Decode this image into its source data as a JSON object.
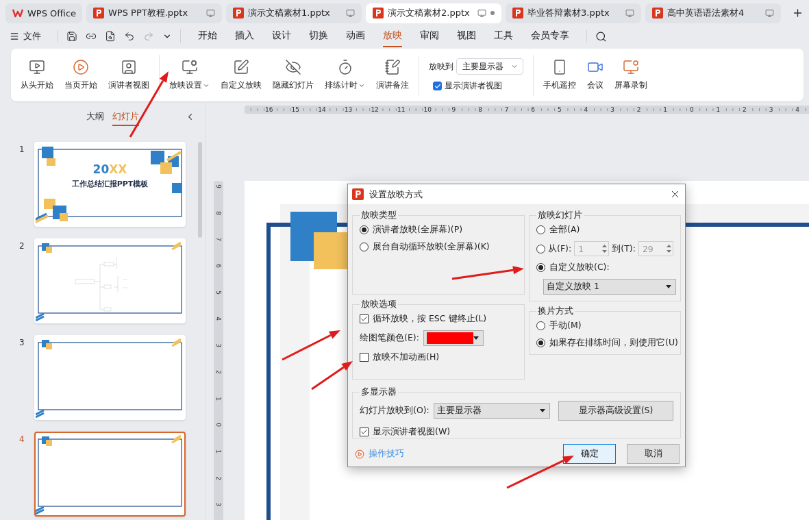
{
  "tabs": [
    {
      "label": "WPS Office",
      "kind": "home",
      "selected": false
    },
    {
      "label": "WPS PPT教程.pptx",
      "kind": "doc",
      "selected": false,
      "unsaved": false
    },
    {
      "label": "演示文稿素材1.pptx",
      "kind": "doc",
      "selected": false,
      "unsaved": false
    },
    {
      "label": "演示文稿素材2.pptx",
      "kind": "doc",
      "selected": true,
      "unsaved": true
    },
    {
      "label": "毕业答辩素材3.pptx",
      "kind": "doc",
      "selected": false,
      "unsaved": false
    },
    {
      "label": "高中英语语法素材4",
      "kind": "doc",
      "selected": false,
      "unsaved": false
    }
  ],
  "menu": {
    "file": "文件",
    "tabs": [
      {
        "label": "开始",
        "selected": false
      },
      {
        "label": "插入",
        "selected": false
      },
      {
        "label": "设计",
        "selected": false
      },
      {
        "label": "切换",
        "selected": false
      },
      {
        "label": "动画",
        "selected": false
      },
      {
        "label": "放映",
        "selected": true
      },
      {
        "label": "审阅",
        "selected": false
      },
      {
        "label": "视图",
        "selected": false
      },
      {
        "label": "工具",
        "selected": false
      },
      {
        "label": "会员专享",
        "selected": false
      }
    ]
  },
  "ribbon": {
    "group_1": [
      {
        "label": "从头开始",
        "dropdown": false
      },
      {
        "label": "当页开始",
        "dropdown": false
      },
      {
        "label": "演讲者视图",
        "dropdown": false
      }
    ],
    "group_2": [
      {
        "label": "放映设置",
        "dropdown": true
      },
      {
        "label": "自定义放映",
        "dropdown": false
      },
      {
        "label": "隐藏幻灯片",
        "dropdown": false
      },
      {
        "label": "排练计时",
        "dropdown": true
      },
      {
        "label": "演讲备注",
        "dropdown": false
      }
    ],
    "show_to": {
      "label": "放映到",
      "value": "主要显示器"
    },
    "presenter_view": {
      "label": "显示演讲者视图",
      "checked": true
    },
    "group_3": [
      {
        "label": "手机遥控",
        "dropdown": false
      },
      {
        "label": "会议",
        "dropdown": false
      },
      {
        "label": "屏幕录制",
        "dropdown": false
      }
    ]
  },
  "panel": {
    "tabs": [
      {
        "label": "大纲",
        "selected": false
      },
      {
        "label": "幻灯片",
        "selected": true
      }
    ],
    "slides": [
      {
        "number": "1",
        "kind": "title",
        "selected": false,
        "heading_a": "20",
        "heading_b": "XX",
        "title": "工作总结汇报PPT模板"
      },
      {
        "number": "2",
        "kind": "mindmap",
        "selected": false
      },
      {
        "number": "3",
        "kind": "blank",
        "selected": false
      },
      {
        "number": "4",
        "kind": "blank",
        "selected": true
      }
    ]
  },
  "rulers": {
    "horizontal": [
      "16",
      "15",
      "14",
      "13",
      "12",
      "11",
      "10",
      "9",
      "8",
      "7",
      "6",
      "5",
      "4",
      "3",
      "2",
      "1",
      "0",
      "1",
      "2",
      "3",
      "4"
    ],
    "vertical": [
      "9",
      "8",
      "7",
      "6",
      "5",
      "4",
      "3",
      "2",
      "1",
      "0",
      "1",
      "2",
      "3"
    ]
  },
  "dialog": {
    "title": "设置放映方式",
    "show_type": {
      "legend": "放映类型",
      "options": [
        {
          "label": "演讲者放映(全屏幕)(P)",
          "selected": true
        },
        {
          "label": "展台自动循环放映(全屏幕)(K)",
          "selected": false
        }
      ]
    },
    "slides": {
      "legend": "放映幻灯片",
      "all": {
        "label": "全部(A)",
        "selected": false
      },
      "range": {
        "label": "从(F):",
        "selected": false,
        "from": "1",
        "to_label": "到(T):",
        "to": "29"
      },
      "custom": {
        "label": "自定义放映(C):",
        "selected": true,
        "value": "自定义放映 1"
      }
    },
    "options": {
      "legend": "放映选项",
      "loop": {
        "label": "循环放映，按 ESC 键终止(L)",
        "checked": true
      },
      "pen_label": "绘图笔颜色(E):",
      "no_animation": {
        "label": "放映不加动画(H)",
        "checked": false
      }
    },
    "advance": {
      "legend": "换片方式",
      "options": [
        {
          "label": "手动(M)",
          "selected": false
        },
        {
          "label": "如果存在排练时间，则使用它(U)",
          "selected": true
        }
      ]
    },
    "monitors": {
      "legend": "多显示器",
      "show_to_label": "幻灯片放映到(O):",
      "show_to_value": "主要显示器",
      "advanced_button": "显示器高级设置(S)",
      "presenter": {
        "label": "显示演讲者视图(W)",
        "checked": true
      }
    },
    "help_link": "操作技巧",
    "buttons": [
      {
        "label": "确定",
        "kind": "primary"
      },
      {
        "label": "取消",
        "kind": "normal"
      }
    ]
  }
}
